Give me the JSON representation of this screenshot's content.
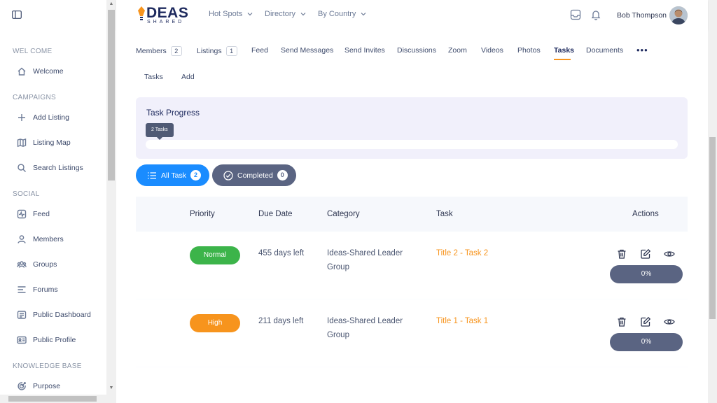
{
  "sidebar": {
    "sections": [
      {
        "title": "WEL COME",
        "items": [
          {
            "label": "Welcome",
            "icon": "home-icon"
          }
        ]
      },
      {
        "title": "CAMPAIGNS",
        "items": [
          {
            "label": "Add Listing",
            "icon": "plus-icon"
          },
          {
            "label": "Listing Map",
            "icon": "map-icon"
          },
          {
            "label": "Search Listings",
            "icon": "search-icon"
          }
        ]
      },
      {
        "title": "SOCIAL",
        "items": [
          {
            "label": "Feed",
            "icon": "activity-icon"
          },
          {
            "label": "Members",
            "icon": "user-icon"
          },
          {
            "label": "Groups",
            "icon": "users-icon"
          },
          {
            "label": "Forums",
            "icon": "list-icon"
          },
          {
            "label": "Public Dashboard",
            "icon": "dashboard-icon"
          },
          {
            "label": "Public Profile",
            "icon": "id-card-icon"
          }
        ]
      },
      {
        "title": "KNOWLEDGE BASE",
        "items": [
          {
            "label": "Purpose",
            "icon": "target-icon"
          }
        ]
      }
    ]
  },
  "topbar": {
    "brand": "DEAS",
    "brand_sub": "SHARED",
    "nav": [
      "Hot Spots",
      "Directory",
      "By Country"
    ],
    "user_name": "Bob Thompson"
  },
  "tabs": [
    {
      "label": "Members",
      "count": "2"
    },
    {
      "label": "Listings",
      "count": "1"
    },
    {
      "label": "Feed"
    },
    {
      "label": "Send Messages"
    },
    {
      "label": "Send Invites"
    },
    {
      "label": "Discussions"
    },
    {
      "label": "Zoom"
    },
    {
      "label": "Videos"
    },
    {
      "label": "Photos"
    },
    {
      "label": "Tasks"
    },
    {
      "label": "Documents"
    }
  ],
  "subtabs": [
    "Tasks",
    "Add"
  ],
  "progress": {
    "title": "Task Progress",
    "tooltip": "2 Tasks",
    "value": 0
  },
  "filters": {
    "all": {
      "label": "All Task",
      "count": "2"
    },
    "completed": {
      "label": "Completed",
      "count": "0"
    }
  },
  "table": {
    "headers": [
      "Priority",
      "Due Date",
      "Category",
      "Task",
      "Actions"
    ],
    "rows": [
      {
        "priority": "Normal",
        "due": "455 days left",
        "category_line1": "Ideas-Shared Leader",
        "category_line2": "Group",
        "task": "Title 2 - Task 2",
        "progress": "0%"
      },
      {
        "priority": "High",
        "due": "211 days left",
        "category_line1": "Ideas-Shared Leader",
        "category_line2": "Group",
        "task": "Title 1 - Task 1",
        "progress": "0%"
      }
    ]
  },
  "colors": {
    "accent": "#f7941d",
    "primary_blue": "#1a8cff",
    "normal_green": "#3cb44a",
    "high_orange": "#f7941d",
    "slate": "#5a6482"
  }
}
